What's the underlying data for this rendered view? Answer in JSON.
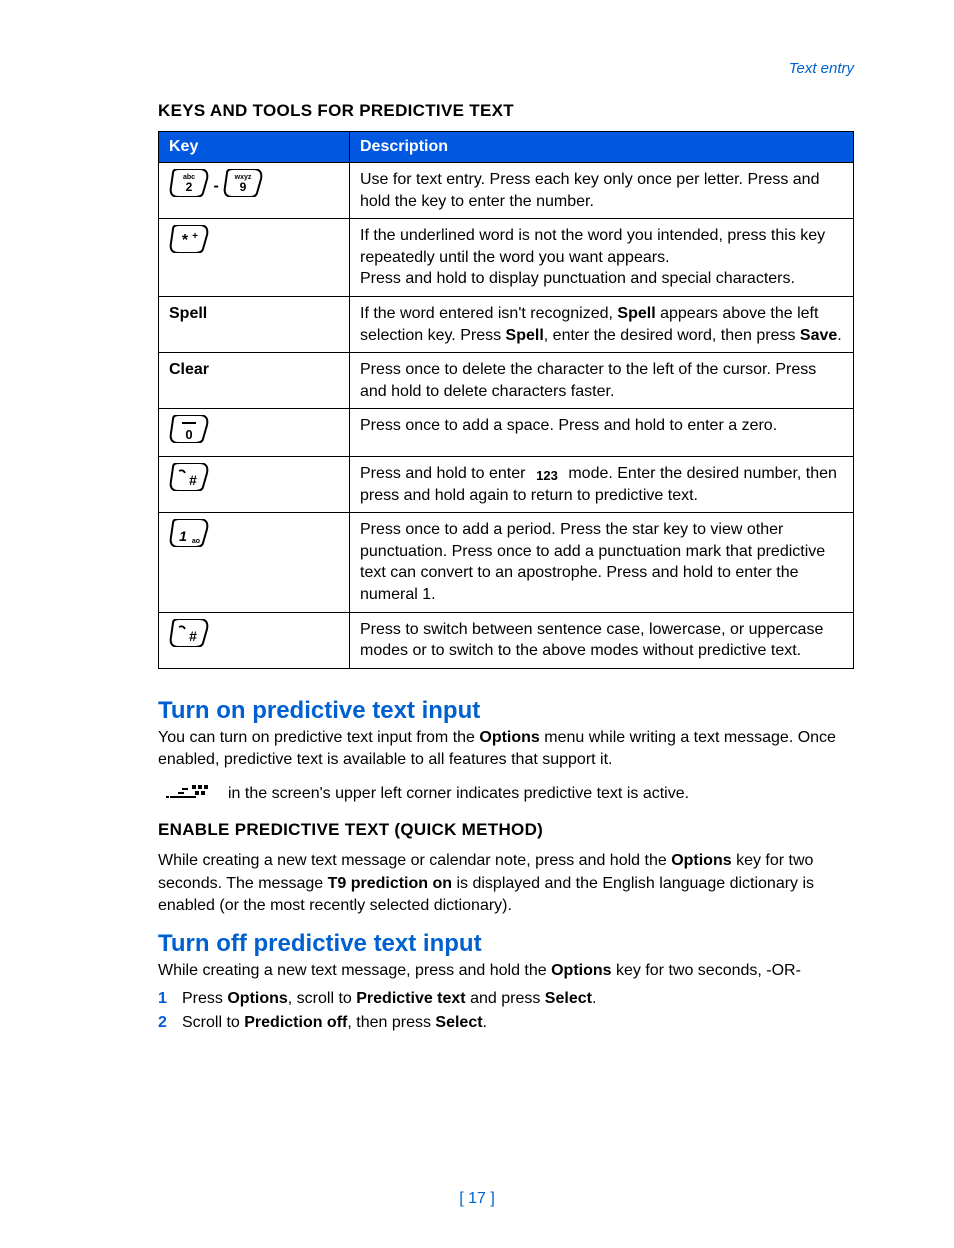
{
  "header": {
    "breadcrumb": "Text entry"
  },
  "section1": {
    "heading": "KEYS AND TOOLS FOR PREDICTIVE TEXT"
  },
  "table": {
    "head": {
      "key": "Key",
      "desc": "Description"
    },
    "rows": [
      {
        "key_type": "icons_2_9",
        "key_label_sep": "-",
        "desc_html": "Use for text entry. Press each key only once per letter. Press and hold the key to enter the number."
      },
      {
        "key_type": "icon_star",
        "desc_html": "If the underlined word is not the word you intended, press this key repeatedly until the word you want appears.<br>Press and hold to display punctuation and special characters."
      },
      {
        "key_type": "text",
        "key_label": "Spell",
        "desc_html": "If the word entered isn't recognized, <strong>Spell</strong> appears above the left selection key. Press <strong>Spell</strong>, enter the desired word, then press <strong>Save</strong>."
      },
      {
        "key_type": "text",
        "key_label": "Clear",
        "desc_html": "Press once to delete the character to the left of the cursor. Press and hold to delete characters faster."
      },
      {
        "key_type": "icon_0",
        "desc_html": "Press once to add a space. Press and hold to enter a zero."
      },
      {
        "key_type": "icon_hash",
        "desc_html": "Press and hold to enter {ICON123} mode. Enter the desired number, then press and hold again to return to predictive text."
      },
      {
        "key_type": "icon_1",
        "desc_html": "Press once to add a period. Press the star key to view other punctuation. Press once to add a punctuation mark that predictive text can convert to an apostrophe. Press and hold to enter the numeral 1."
      },
      {
        "key_type": "icon_hash",
        "desc_html": "Press to switch between sentence case, lowercase, or uppercase modes or to switch to the above modes without predictive text."
      }
    ]
  },
  "turn_on": {
    "heading": "Turn on predictive text input",
    "body_html": "You can turn on predictive text input from the <strong>Options</strong> menu while writing a text message. Once enabled, predictive text is available to all features that support it.",
    "indicator_text": "in the screen's upper left corner indicates predictive text is active."
  },
  "enable_quick": {
    "heading": "ENABLE PREDICTIVE TEXT (QUICK METHOD)",
    "body_html": "While creating a new text message or calendar note, press and hold the <strong>Options</strong> key for two seconds. The message <strong>T9 prediction on</strong> is displayed and the English language dictionary is enabled (or the most recently selected dictionary)."
  },
  "turn_off": {
    "heading": "Turn off predictive text input",
    "body_html": "While creating a new text message, press and hold the <strong>Options</strong> key for two seconds, -OR-",
    "steps": [
      {
        "n": "1",
        "html": "Press <strong>Options</strong>, scroll to <strong>Predictive text</strong> and press <strong>Select</strong>."
      },
      {
        "n": "2",
        "html": "Scroll to <strong>Prediction off</strong>, then press <strong>Select</strong>."
      }
    ]
  },
  "page_number": "[ 17 ]"
}
